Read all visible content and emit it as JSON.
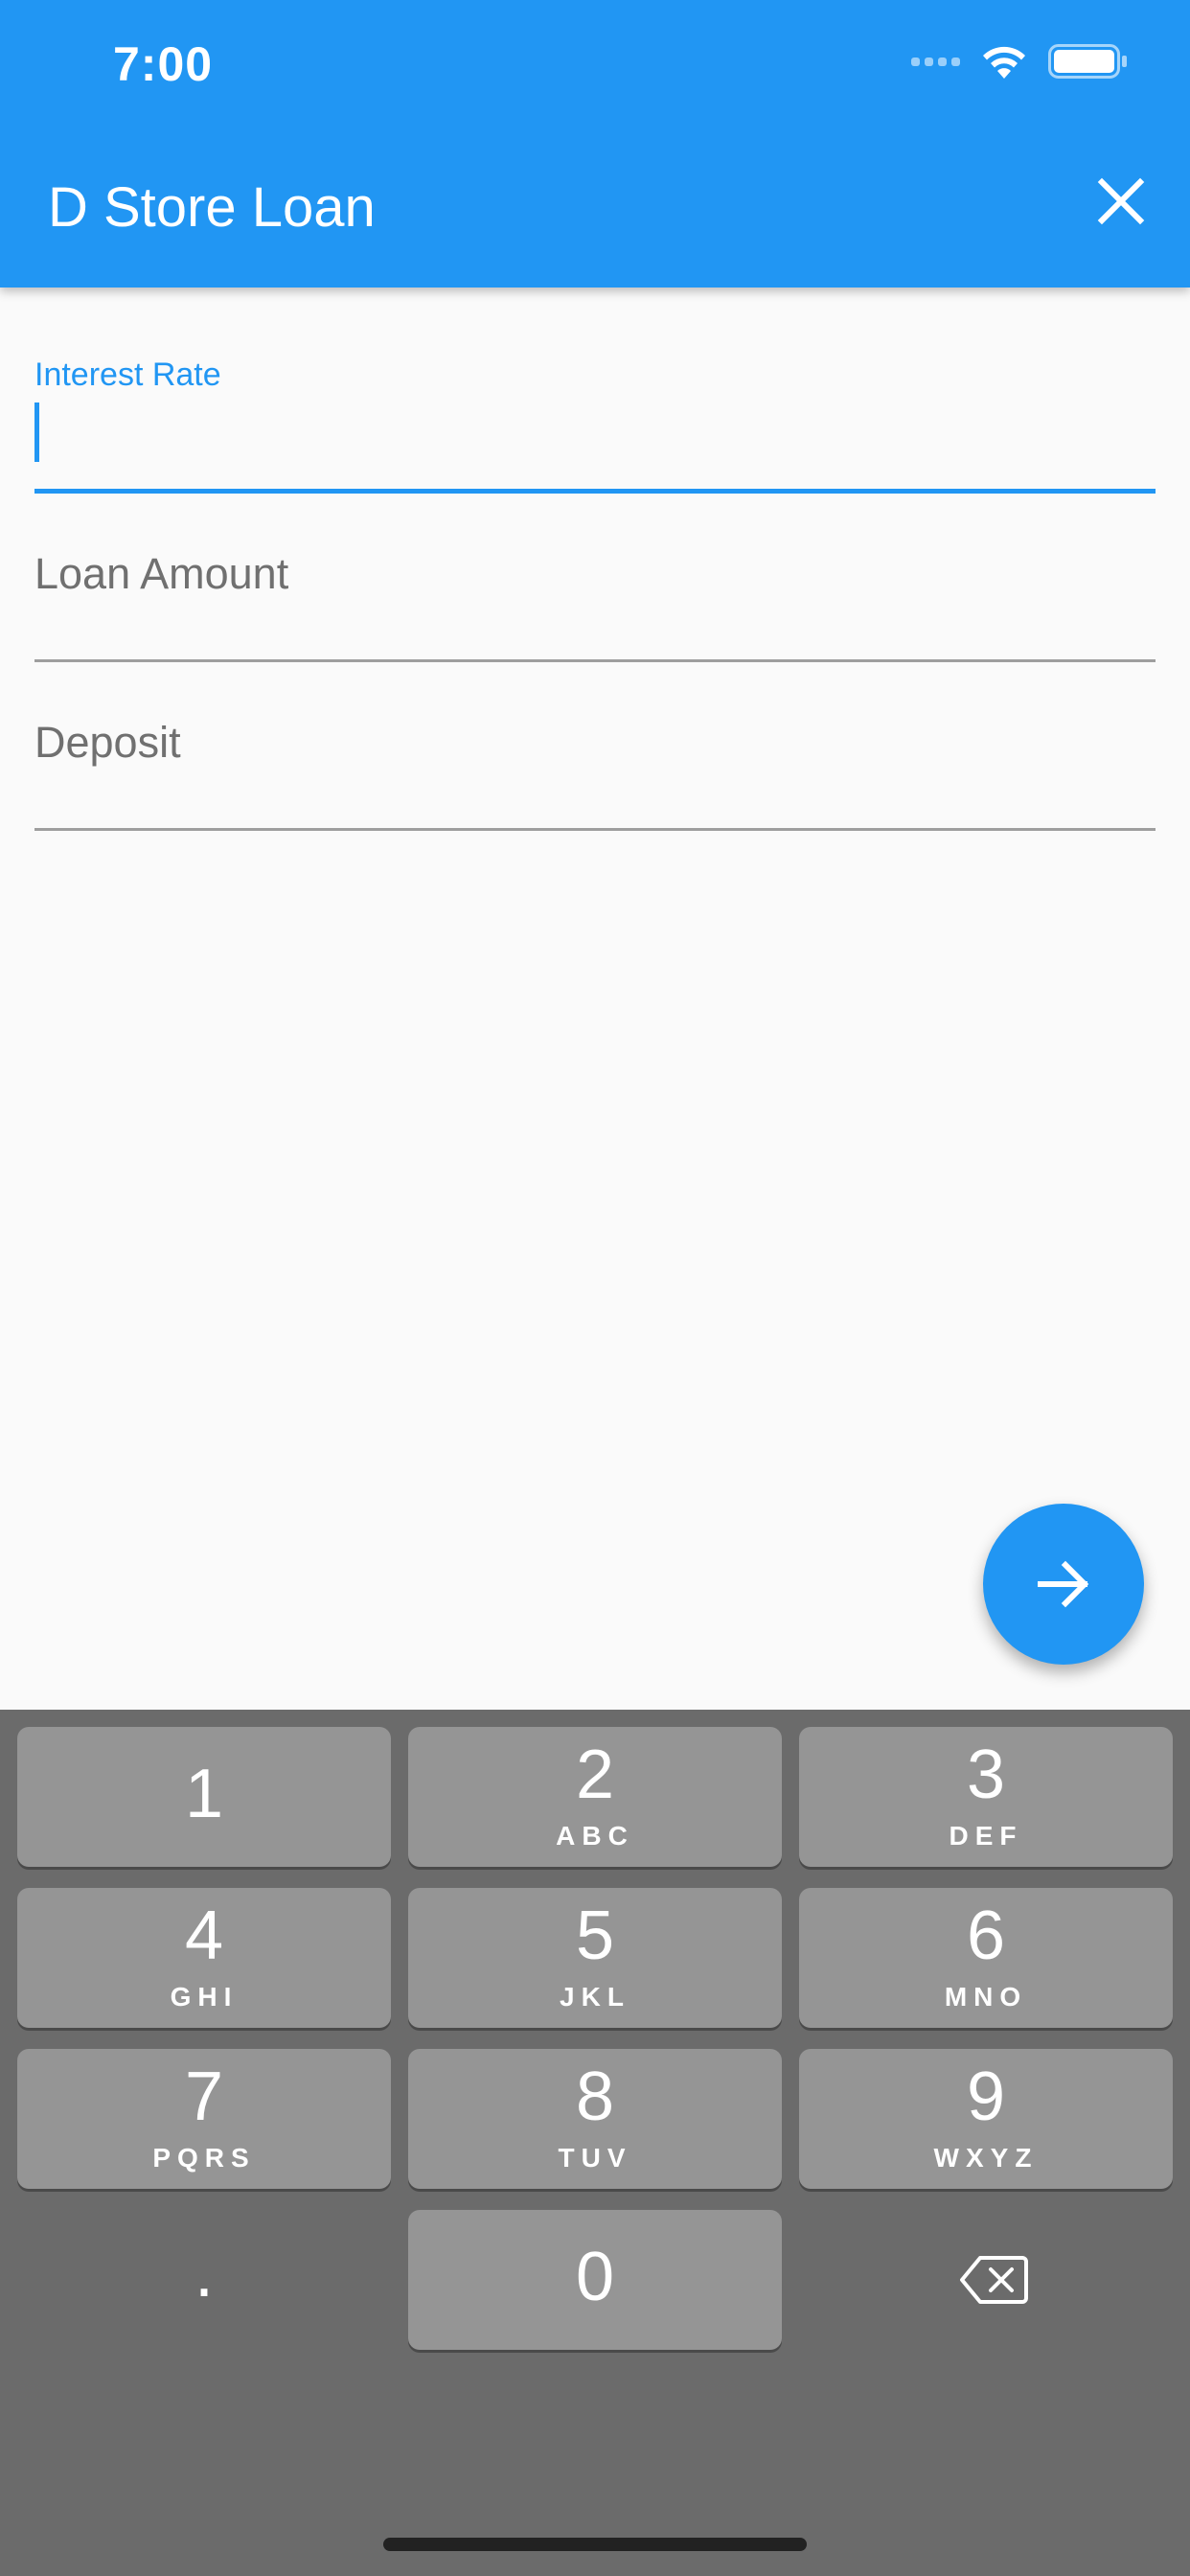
{
  "status_bar": {
    "time": "7:00",
    "signal_icon": "signal-dots-icon",
    "wifi_icon": "wifi-icon",
    "battery_icon": "battery-icon"
  },
  "app_bar": {
    "title": "D Store Loan",
    "close_icon": "close-icon",
    "background_color": "#2196f3"
  },
  "form": {
    "interest_rate": {
      "label": "Interest Rate",
      "value": "",
      "focused": true
    },
    "loan_amount": {
      "label": "Loan Amount",
      "value": ""
    },
    "deposit": {
      "label": "Deposit",
      "value": ""
    }
  },
  "fab": {
    "icon": "arrow-right-icon"
  },
  "keyboard": {
    "keys": [
      {
        "num": "1",
        "letters": ""
      },
      {
        "num": "2",
        "letters": "ABC"
      },
      {
        "num": "3",
        "letters": "DEF"
      },
      {
        "num": "4",
        "letters": "GHI"
      },
      {
        "num": "5",
        "letters": "JKL"
      },
      {
        "num": "6",
        "letters": "MNO"
      },
      {
        "num": "7",
        "letters": "PQRS"
      },
      {
        "num": "8",
        "letters": "TUV"
      },
      {
        "num": "9",
        "letters": "WXYZ"
      },
      {
        "num": "0",
        "letters": ""
      }
    ],
    "decimal": ".",
    "backspace_icon": "backspace-icon"
  }
}
